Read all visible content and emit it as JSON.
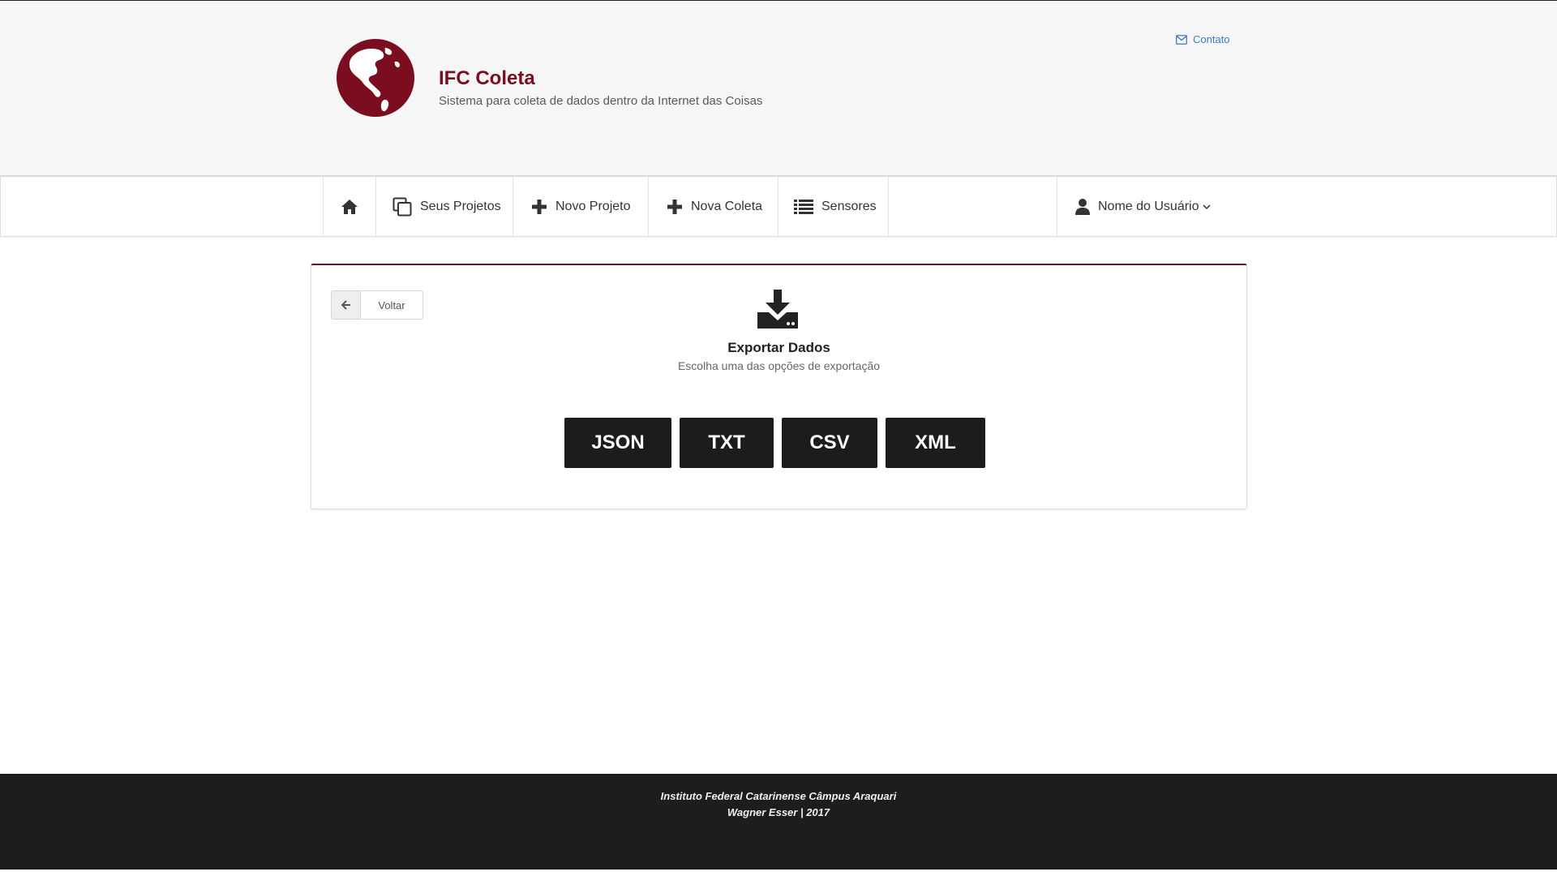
{
  "header": {
    "title": "IFC Coleta",
    "subtitle": "Sistema para coleta de dados dentro da Internet das Coisas",
    "contact_label": "Contato"
  },
  "nav": {
    "home_icon": "home-icon",
    "items": [
      {
        "label": "Seus Projetos",
        "icon": "copy-icon"
      },
      {
        "label": "Novo Projeto",
        "icon": "plus-icon"
      },
      {
        "label": "Nova Coleta",
        "icon": "plus-icon"
      },
      {
        "label": "Sensores",
        "icon": "list-icon"
      }
    ],
    "user_label": "Nome do Usuário"
  },
  "export": {
    "back_label": "Voltar",
    "title": "Exportar Dados",
    "subtitle": "Escolha uma das opções de exportação",
    "formats": [
      "JSON",
      "TXT",
      "CSV",
      "XML"
    ]
  },
  "footer": {
    "line1": "Instituto Federal Catarinense Câmpus Araquari",
    "line2": "Wagner Esser | 2017"
  },
  "colors": {
    "brand": "#7a0d1f",
    "link": "#3a7dc0",
    "dark": "#1b1c1e"
  }
}
